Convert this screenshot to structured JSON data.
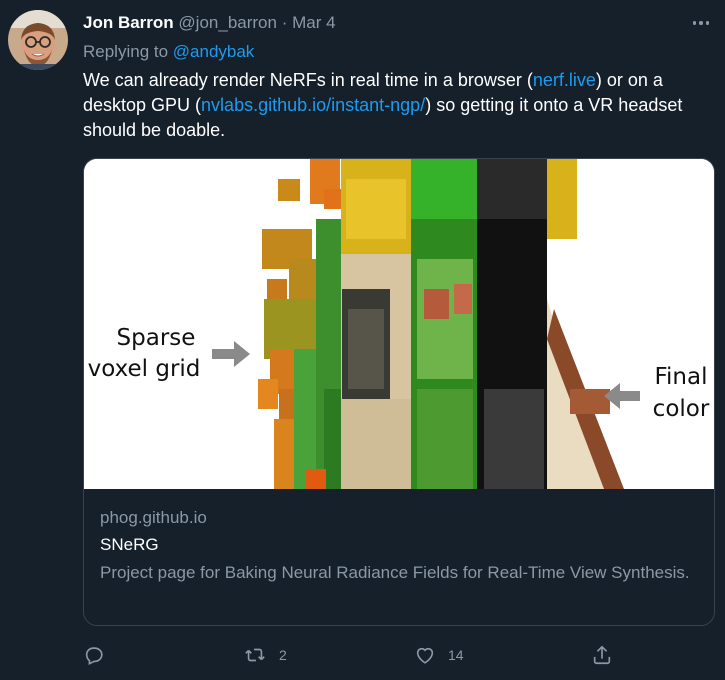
{
  "author": {
    "name": "Jon Barron",
    "handle": "@jon_barron",
    "separator": "·",
    "date": "Mar 4"
  },
  "reply": {
    "prefix": "Replying to ",
    "to": "@andybak"
  },
  "body": {
    "t1": "We can already render NeRFs in real time in a browser (",
    "link1": "nerf.live",
    "t2": ") or on a desktop GPU (",
    "link2": "nvlabs.github.io/instant-ngp/",
    "t3": ") so getting it onto a VR headset should be doable."
  },
  "card": {
    "image_labels": {
      "left_line1": "Sparse",
      "left_line2": "voxel grid",
      "right_line1": "Final",
      "right_line2": "color"
    },
    "domain": "phog.github.io",
    "title": "SNeRG",
    "description": "Project page for Baking Neural Radiance Fields for Real-Time View Synthesis."
  },
  "actions": {
    "reply_count": "",
    "retweet_count": "2",
    "like_count": "14"
  },
  "icons": [
    "ellipsis-icon",
    "reply-icon",
    "retweet-icon",
    "like-icon",
    "share-icon"
  ],
  "colors": {
    "background": "#15202b",
    "link": "#1d9bf0",
    "muted": "#8b98a5",
    "text": "#ffffff",
    "border": "#38444d"
  }
}
